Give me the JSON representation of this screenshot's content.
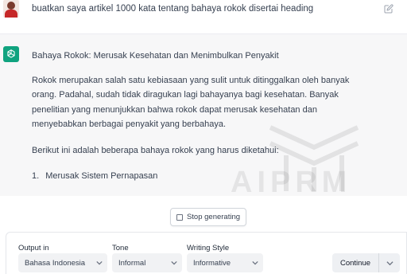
{
  "user_message": {
    "text": "buatkan saya artikel 1000 kata tentang bahaya rokok disertai heading"
  },
  "assistant_message": {
    "title": "Bahaya Rokok: Merusak Kesehatan dan Menimbulkan Penyakit",
    "paragraph1": "Rokok merupakan salah satu kebiasaan yang sulit untuk ditinggalkan oleh banyak orang. Padahal, sudah tidak diragukan lagi bahayanya bagi kesehatan. Banyak penelitian yang menunjukkan bahwa rokok dapat merusak kesehatan dan menyebabkan berbagai penyakit yang berbahaya.",
    "paragraph2": "Berikut ini adalah beberapa bahaya rokok yang harus diketahui:",
    "list": [
      {
        "number": "1.",
        "text": "Merusak Sistem Pernapasan"
      }
    ]
  },
  "watermark": {
    "text": "AIPRM"
  },
  "stop_button": {
    "label": "Stop generating",
    "icon": "stop-square-icon"
  },
  "controls": {
    "output_in": {
      "label": "Output in",
      "value": "Bahasa Indonesia"
    },
    "tone": {
      "label": "Tone",
      "value": "Informal"
    },
    "writing_style": {
      "label": "Writing Style",
      "value": "Informative"
    },
    "continue_label": "Continue"
  },
  "colors": {
    "assistant_bg": "#f7f7f8",
    "gpt_logo": "#10a37f",
    "avatar_shirt": "#c62828"
  }
}
